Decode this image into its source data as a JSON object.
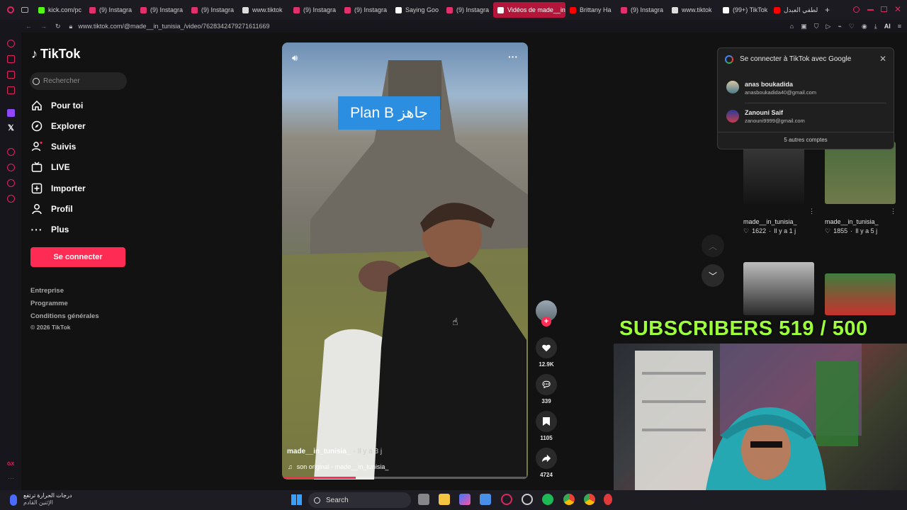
{
  "browser": {
    "tabs": [
      {
        "label": "kick.com/pc",
        "color": "#53fc18"
      },
      {
        "label": "(9) Instagra",
        "color": "#e1306c"
      },
      {
        "label": "(9) Instagra",
        "color": "#e1306c"
      },
      {
        "label": "(9) Instagra",
        "color": "#e1306c"
      },
      {
        "label": "www.tiktok",
        "color": "#dddddd"
      },
      {
        "label": "(9) Instagra",
        "color": "#e1306c"
      },
      {
        "label": "(9) Instagra",
        "color": "#e1306c"
      },
      {
        "label": "Saying Goo",
        "color": "#ffffff"
      },
      {
        "label": "(9) Instagra",
        "color": "#e1306c"
      },
      {
        "label": "Vidéos de made__in_",
        "color": "#ffffff"
      },
      {
        "label": "Brittany Ha",
        "color": "#ff0000"
      },
      {
        "label": "(9) Instagra",
        "color": "#e1306c"
      },
      {
        "label": "www.tiktok",
        "color": "#dddddd"
      },
      {
        "label": "(99+) TikTok",
        "color": "#ffffff"
      },
      {
        "label": "لطفي العبدل",
        "color": "#ff0000"
      }
    ],
    "url": "www.tiktok.com/@made__in_tunisia_/video/7628342479271611669",
    "ai_label": "AI"
  },
  "sidebar": {
    "logo": "TikTok",
    "search_placeholder": "Rechercher",
    "nav": [
      {
        "label": "Pour toi",
        "icon": "home-icon"
      },
      {
        "label": "Explorer",
        "icon": "compass-icon"
      },
      {
        "label": "Suivis",
        "icon": "following-icon"
      },
      {
        "label": "LIVE",
        "icon": "live-icon"
      },
      {
        "label": "Importer",
        "icon": "upload-icon"
      },
      {
        "label": "Profil",
        "icon": "profile-icon"
      },
      {
        "label": "Plus",
        "icon": "more-icon"
      }
    ],
    "login_button": "Se connecter",
    "footer": [
      "Entreprise",
      "Programme",
      "Conditions générales",
      "© 2026 TikTok"
    ]
  },
  "video": {
    "overlay_text": "Plan B جاهز",
    "author": "made__in_tunisia_",
    "time_ago": "· Il y a 3 j",
    "sound": "son original - made__in_tunisia_",
    "likes": "12.9K",
    "comments": "339",
    "bookmarks": "1105",
    "shares": "4724"
  },
  "google_popup": {
    "title": "Se connecter à TikTok avec Google",
    "accounts": [
      {
        "name": "anas boukadida",
        "email": "anasboukadida40@gmail.com"
      },
      {
        "name": "Zanouni Saif",
        "email": "zanouni9999@gmail.com"
      }
    ],
    "more": "5 autres comptes"
  },
  "related": [
    {
      "author": "made__in_tunisia_",
      "likes": "1622",
      "ago": "Il y a 1 j"
    },
    {
      "author": "made__in_tunisia_",
      "likes": "1855",
      "ago": "Il y a 5 j"
    }
  ],
  "stream": {
    "subscribers": "SUBSCRIBERS 519 / 500"
  },
  "taskbar": {
    "weather_line1": "درجات الحرارة ترتفع",
    "weather_line2": "الإثنين القادم",
    "search": "Search"
  }
}
